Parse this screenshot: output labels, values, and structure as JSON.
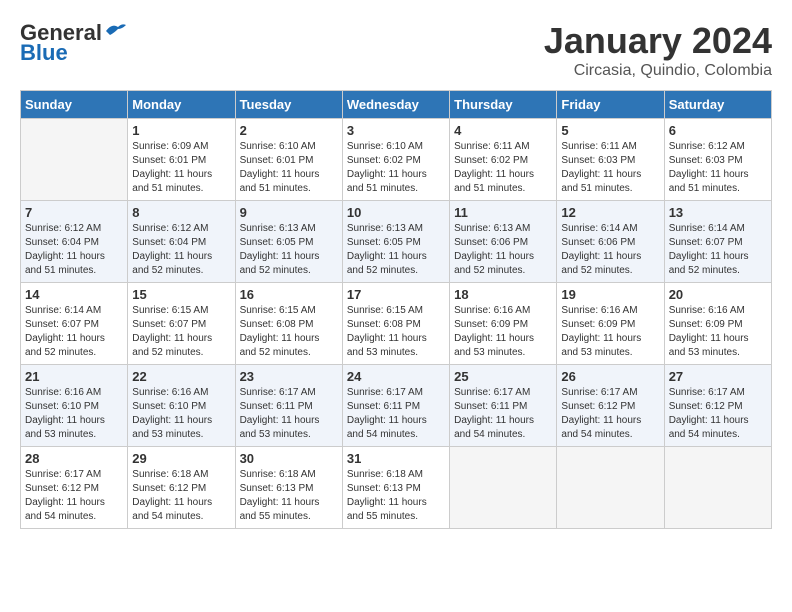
{
  "header": {
    "logo_line1": "General",
    "logo_line2": "Blue",
    "month_title": "January 2024",
    "subtitle": "Circasia, Quindio, Colombia"
  },
  "days_of_week": [
    "Sunday",
    "Monday",
    "Tuesday",
    "Wednesday",
    "Thursday",
    "Friday",
    "Saturday"
  ],
  "weeks": [
    [
      {
        "num": "",
        "empty": true
      },
      {
        "num": "1",
        "sunrise": "6:09 AM",
        "sunset": "6:01 PM",
        "daylight": "11 hours and 51 minutes."
      },
      {
        "num": "2",
        "sunrise": "6:10 AM",
        "sunset": "6:01 PM",
        "daylight": "11 hours and 51 minutes."
      },
      {
        "num": "3",
        "sunrise": "6:10 AM",
        "sunset": "6:02 PM",
        "daylight": "11 hours and 51 minutes."
      },
      {
        "num": "4",
        "sunrise": "6:11 AM",
        "sunset": "6:02 PM",
        "daylight": "11 hours and 51 minutes."
      },
      {
        "num": "5",
        "sunrise": "6:11 AM",
        "sunset": "6:03 PM",
        "daylight": "11 hours and 51 minutes."
      },
      {
        "num": "6",
        "sunrise": "6:12 AM",
        "sunset": "6:03 PM",
        "daylight": "11 hours and 51 minutes."
      }
    ],
    [
      {
        "num": "7",
        "sunrise": "6:12 AM",
        "sunset": "6:04 PM",
        "daylight": "11 hours and 51 minutes."
      },
      {
        "num": "8",
        "sunrise": "6:12 AM",
        "sunset": "6:04 PM",
        "daylight": "11 hours and 52 minutes."
      },
      {
        "num": "9",
        "sunrise": "6:13 AM",
        "sunset": "6:05 PM",
        "daylight": "11 hours and 52 minutes."
      },
      {
        "num": "10",
        "sunrise": "6:13 AM",
        "sunset": "6:05 PM",
        "daylight": "11 hours and 52 minutes."
      },
      {
        "num": "11",
        "sunrise": "6:13 AM",
        "sunset": "6:06 PM",
        "daylight": "11 hours and 52 minutes."
      },
      {
        "num": "12",
        "sunrise": "6:14 AM",
        "sunset": "6:06 PM",
        "daylight": "11 hours and 52 minutes."
      },
      {
        "num": "13",
        "sunrise": "6:14 AM",
        "sunset": "6:07 PM",
        "daylight": "11 hours and 52 minutes."
      }
    ],
    [
      {
        "num": "14",
        "sunrise": "6:14 AM",
        "sunset": "6:07 PM",
        "daylight": "11 hours and 52 minutes."
      },
      {
        "num": "15",
        "sunrise": "6:15 AM",
        "sunset": "6:07 PM",
        "daylight": "11 hours and 52 minutes."
      },
      {
        "num": "16",
        "sunrise": "6:15 AM",
        "sunset": "6:08 PM",
        "daylight": "11 hours and 52 minutes."
      },
      {
        "num": "17",
        "sunrise": "6:15 AM",
        "sunset": "6:08 PM",
        "daylight": "11 hours and 53 minutes."
      },
      {
        "num": "18",
        "sunrise": "6:16 AM",
        "sunset": "6:09 PM",
        "daylight": "11 hours and 53 minutes."
      },
      {
        "num": "19",
        "sunrise": "6:16 AM",
        "sunset": "6:09 PM",
        "daylight": "11 hours and 53 minutes."
      },
      {
        "num": "20",
        "sunrise": "6:16 AM",
        "sunset": "6:09 PM",
        "daylight": "11 hours and 53 minutes."
      }
    ],
    [
      {
        "num": "21",
        "sunrise": "6:16 AM",
        "sunset": "6:10 PM",
        "daylight": "11 hours and 53 minutes."
      },
      {
        "num": "22",
        "sunrise": "6:16 AM",
        "sunset": "6:10 PM",
        "daylight": "11 hours and 53 minutes."
      },
      {
        "num": "23",
        "sunrise": "6:17 AM",
        "sunset": "6:11 PM",
        "daylight": "11 hours and 53 minutes."
      },
      {
        "num": "24",
        "sunrise": "6:17 AM",
        "sunset": "6:11 PM",
        "daylight": "11 hours and 54 minutes."
      },
      {
        "num": "25",
        "sunrise": "6:17 AM",
        "sunset": "6:11 PM",
        "daylight": "11 hours and 54 minutes."
      },
      {
        "num": "26",
        "sunrise": "6:17 AM",
        "sunset": "6:12 PM",
        "daylight": "11 hours and 54 minutes."
      },
      {
        "num": "27",
        "sunrise": "6:17 AM",
        "sunset": "6:12 PM",
        "daylight": "11 hours and 54 minutes."
      }
    ],
    [
      {
        "num": "28",
        "sunrise": "6:17 AM",
        "sunset": "6:12 PM",
        "daylight": "11 hours and 54 minutes."
      },
      {
        "num": "29",
        "sunrise": "6:18 AM",
        "sunset": "6:12 PM",
        "daylight": "11 hours and 54 minutes."
      },
      {
        "num": "30",
        "sunrise": "6:18 AM",
        "sunset": "6:13 PM",
        "daylight": "11 hours and 55 minutes."
      },
      {
        "num": "31",
        "sunrise": "6:18 AM",
        "sunset": "6:13 PM",
        "daylight": "11 hours and 55 minutes."
      },
      {
        "num": "",
        "empty": true
      },
      {
        "num": "",
        "empty": true
      },
      {
        "num": "",
        "empty": true
      }
    ]
  ],
  "labels": {
    "sunrise": "Sunrise: ",
    "sunset": "Sunset: ",
    "daylight": "Daylight: "
  }
}
